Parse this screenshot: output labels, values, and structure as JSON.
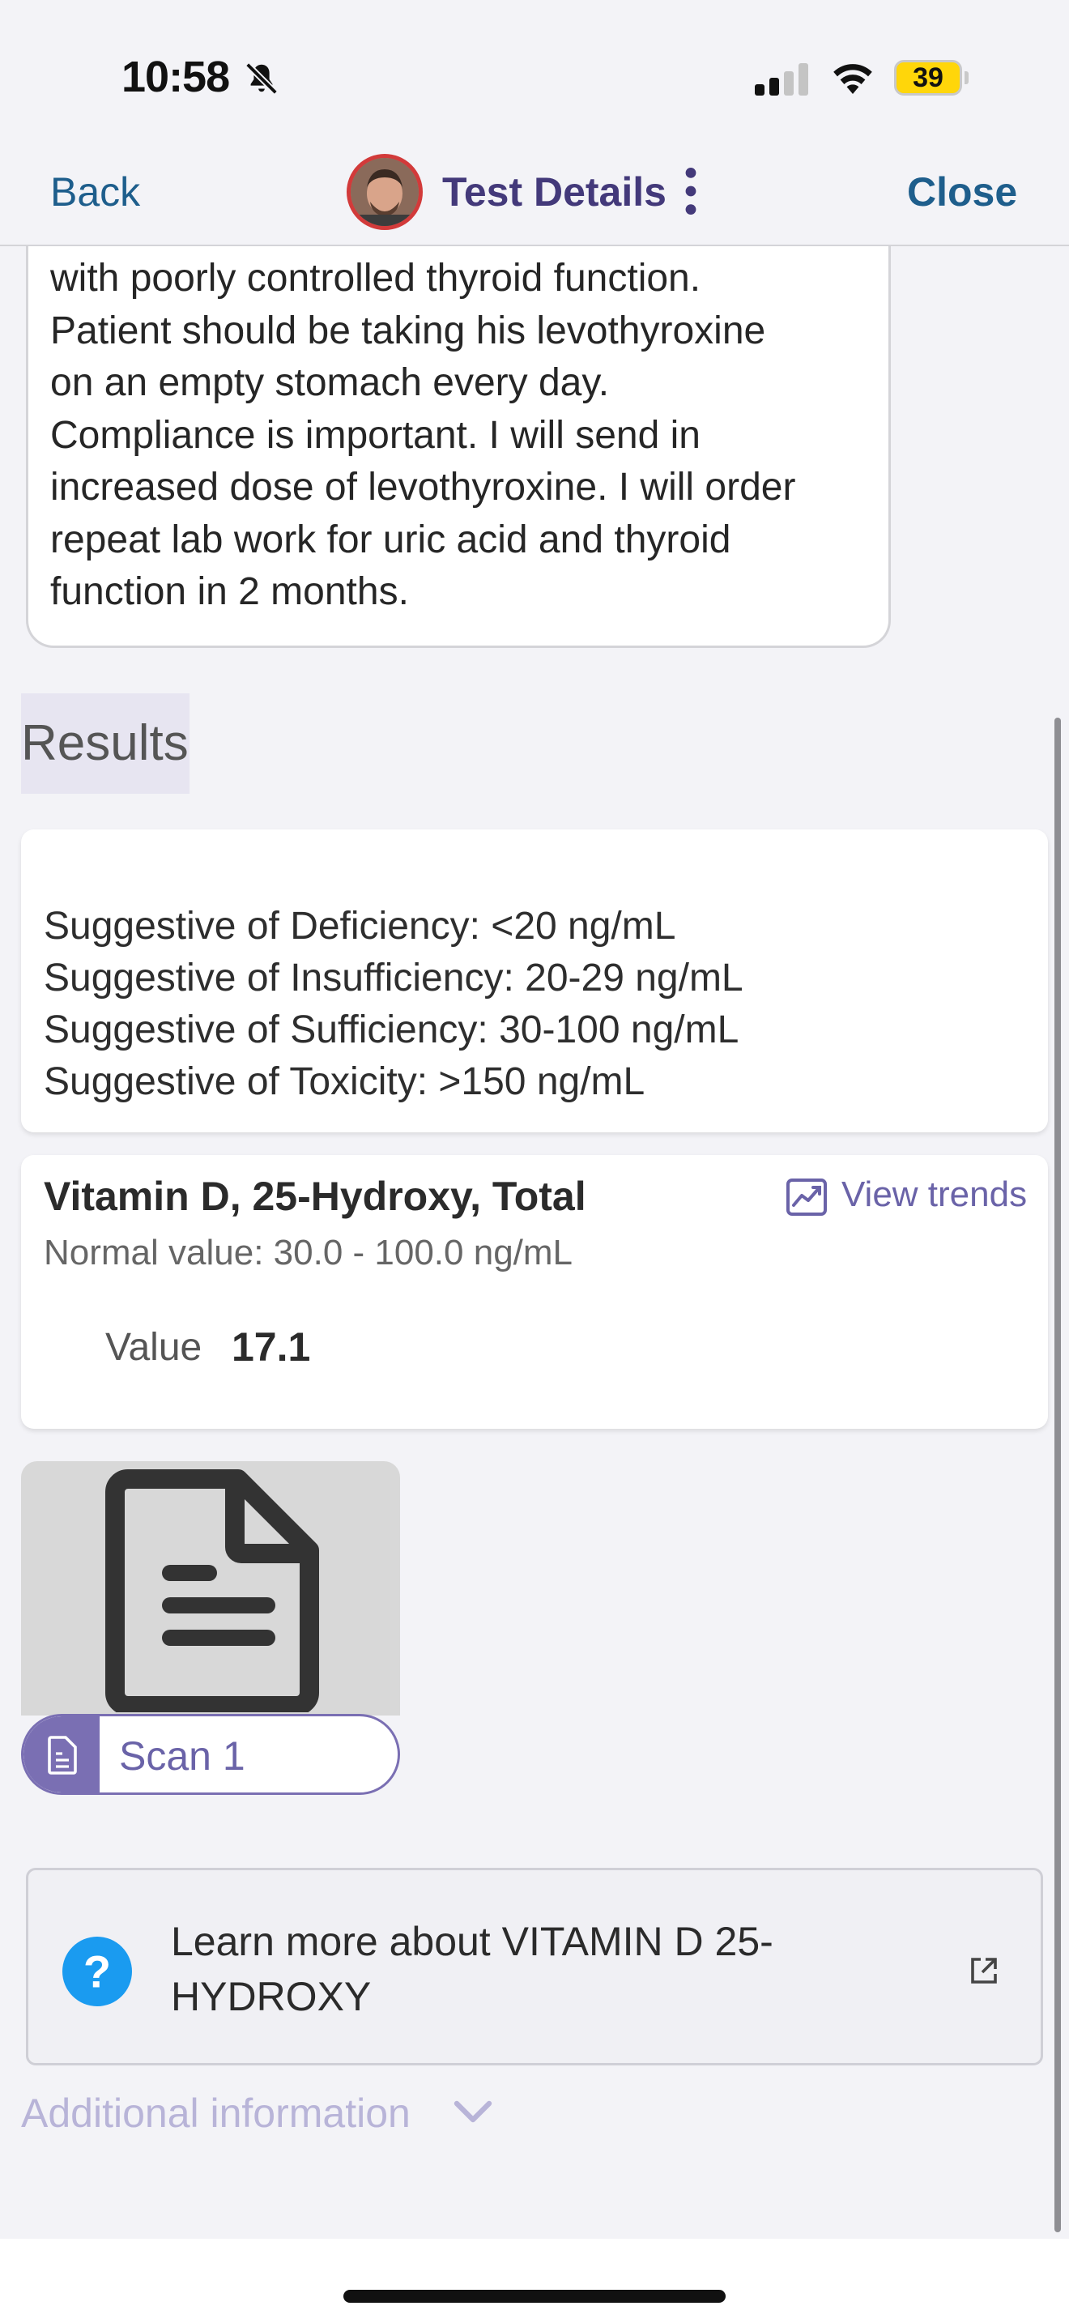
{
  "status_bar": {
    "time": "10:58",
    "battery_level": "39",
    "icons": [
      "bell-slash-icon",
      "cellular-signal-icon",
      "wifi-icon",
      "battery-icon"
    ]
  },
  "nav": {
    "back_label": "Back",
    "title": "Test Details",
    "close_label": "Close",
    "title_color": "#43397a",
    "link_color": "#1e5e8c"
  },
  "note": {
    "lines": [
      "with poorly controlled thyroid function.",
      "Patient should be taking his levothyroxine",
      "on an empty stomach every day.",
      "Compliance is important. I will send in",
      "increased dose of levothyroxine. I will order",
      "repeat lab work for uric acid and thyroid",
      "function in 2 months."
    ]
  },
  "results": {
    "heading": "Results",
    "reference_ranges": [
      "Suggestive of Deficiency: <20 ng/mL",
      "Suggestive of Insufficiency: 20-29 ng/mL",
      "Suggestive of Sufficiency: 30-100 ng/mL",
      "Suggestive of Toxicity: >150 ng/mL"
    ],
    "test": {
      "name": "Vitamin D, 25-Hydroxy, Total",
      "trends_label": "View trends",
      "normal_value": "Normal value: 30.0 - 100.0 ng/mL",
      "value_label": "Value",
      "value": "17.1"
    }
  },
  "scan": {
    "label": "Scan 1",
    "accent": "#7a6fb3"
  },
  "learn_more": {
    "text": "Learn more about VITAMIN D 25-HYDROXY",
    "help_color": "#1a9bf0"
  },
  "additional": {
    "label": "Additional information"
  }
}
